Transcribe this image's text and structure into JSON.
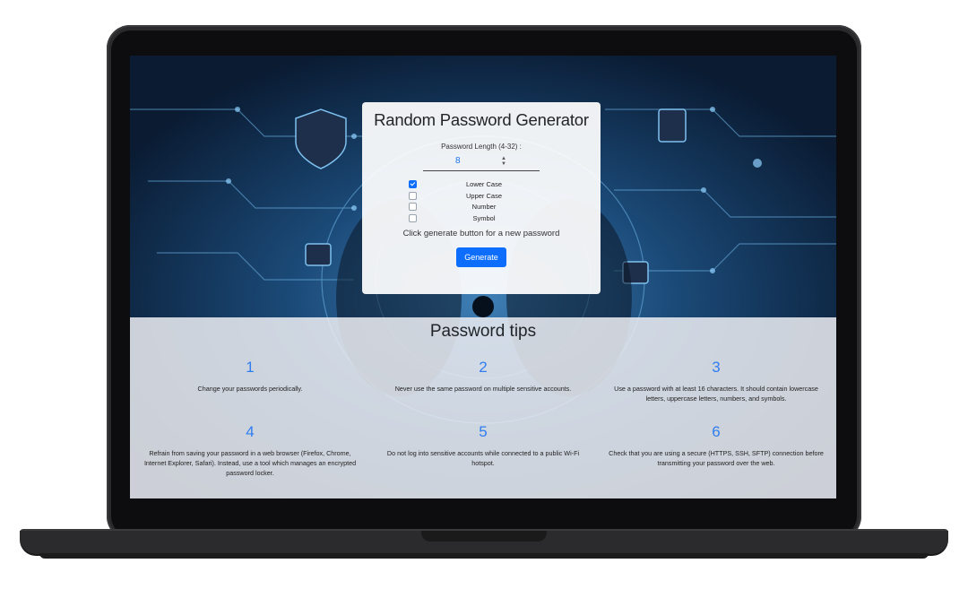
{
  "generator": {
    "title": "Random Password Generator",
    "length_label": "Password Length (4-32) :",
    "length_value": "8",
    "options": [
      {
        "label": "Lower Case",
        "checked": true
      },
      {
        "label": "Upper Case",
        "checked": false
      },
      {
        "label": "Number",
        "checked": false
      },
      {
        "label": "Symbol",
        "checked": false
      }
    ],
    "hint": "Click generate button for a new password",
    "button_label": "Generate"
  },
  "tips": {
    "title": "Password tips",
    "items": [
      {
        "number": "1",
        "text": "Change your passwords periodically."
      },
      {
        "number": "2",
        "text": "Never use the same password on multiple sensitive accounts."
      },
      {
        "number": "3",
        "text": "Use a password with at least 16 characters. It should contain lowercase letters, uppercase letters, numbers, and symbols."
      },
      {
        "number": "4",
        "text": "Refrain from saving your password in a web browser (Firefox, Chrome, Internet Explorer, Safari). Instead, use a tool which manages an encrypted password locker."
      },
      {
        "number": "5",
        "text": "Do not log into sensitive accounts while connected to a public Wi-Fi hotspot."
      },
      {
        "number": "6",
        "text": "Check that you are using a secure (HTTPS, SSH, SFTP) connection before transmitting your password over the web."
      }
    ]
  },
  "colors": {
    "accent": "#0d6efd",
    "tip_number": "#2f7df0",
    "background": "#0b1e37"
  }
}
